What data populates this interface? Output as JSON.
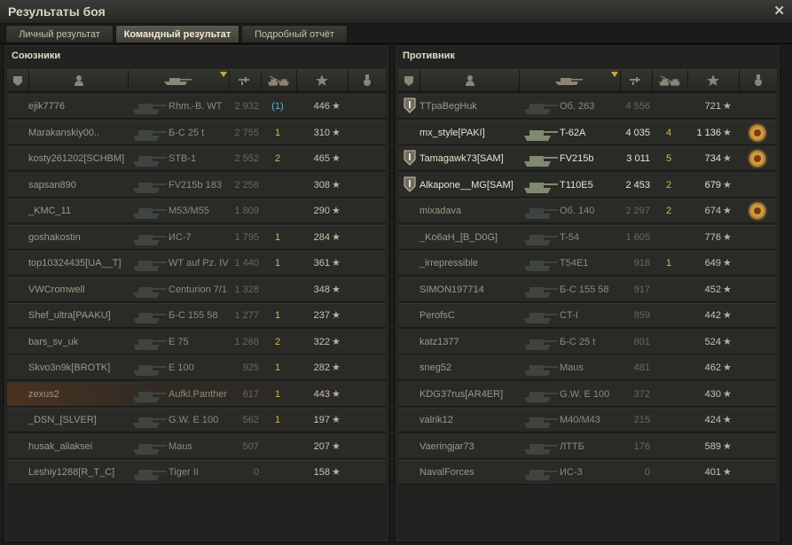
{
  "window": {
    "title": "Результаты боя",
    "close_glyph": "✕"
  },
  "tabs": [
    {
      "label": "Личный результат",
      "active": false
    },
    {
      "label": "Командный результат",
      "active": true
    },
    {
      "label": "Подробный отчёт",
      "active": false
    }
  ],
  "columns": {
    "icons": [
      "squad-icon",
      "player-icon",
      "tank-icon",
      "sort-arrow-icon",
      "damage-icon",
      "kills-icon",
      "xp-star-icon",
      "medal-icon"
    ]
  },
  "allies": {
    "title": "Союзники",
    "rows": [
      {
        "player": "ejik7776",
        "tank": "Rhm.-B. WT",
        "damage": "2 932",
        "kills": "(1)",
        "xp": "446",
        "alive": false,
        "highlight": false,
        "platoon": false,
        "medal": false,
        "prem": true
      },
      {
        "player": "Marakanskiy00..",
        "tank": "Б-С 25 t",
        "damage": "2 755",
        "kills": "1",
        "xp": "310",
        "alive": false,
        "highlight": false,
        "platoon": false,
        "medal": false,
        "prem": false
      },
      {
        "player": "kosty261202[SCHBM]",
        "tank": "STB-1",
        "damage": "2 552",
        "kills": "2",
        "xp": "465",
        "alive": false,
        "highlight": false,
        "platoon": false,
        "medal": false,
        "prem": false
      },
      {
        "player": "sapsan890",
        "tank": "FV215b 183",
        "damage": "2 258",
        "kills": "",
        "xp": "308",
        "alive": false,
        "highlight": false,
        "platoon": false,
        "medal": false,
        "prem": false
      },
      {
        "player": "_KMC_11",
        "tank": "M53/M55",
        "damage": "1 809",
        "kills": "",
        "xp": "290",
        "alive": false,
        "highlight": false,
        "platoon": false,
        "medal": false,
        "prem": false
      },
      {
        "player": "goshakostin",
        "tank": "ИС-7",
        "damage": "1 795",
        "kills": "1",
        "xp": "284",
        "alive": false,
        "highlight": false,
        "platoon": false,
        "medal": false,
        "prem": false
      },
      {
        "player": "top10324435[UA__T]",
        "tank": "WT auf Pz. IV",
        "damage": "1 440",
        "kills": "1",
        "xp": "361",
        "alive": false,
        "highlight": false,
        "platoon": false,
        "medal": false,
        "prem": false
      },
      {
        "player": "VWCromwell",
        "tank": "Centurion 7/1",
        "damage": "1 328",
        "kills": "",
        "xp": "348",
        "alive": false,
        "highlight": false,
        "platoon": false,
        "medal": false,
        "prem": false
      },
      {
        "player": "Shef_ultra[PAAKU]",
        "tank": "Б-С 155 58",
        "damage": "1 277",
        "kills": "1",
        "xp": "237",
        "alive": false,
        "highlight": false,
        "platoon": false,
        "medal": false,
        "prem": false
      },
      {
        "player": "bars_sv_uk",
        "tank": "E 75",
        "damage": "1 268",
        "kills": "2",
        "xp": "322",
        "alive": false,
        "highlight": false,
        "platoon": false,
        "medal": false,
        "prem": false
      },
      {
        "player": "Skvo3n9k[BROTK]",
        "tank": "E 100",
        "damage": "925",
        "kills": "1",
        "xp": "282",
        "alive": false,
        "highlight": false,
        "platoon": false,
        "medal": false,
        "prem": false
      },
      {
        "player": "zexus2",
        "tank": "Aufkl.Panther",
        "damage": "617",
        "kills": "1",
        "xp": "443",
        "alive": false,
        "highlight": true,
        "platoon": false,
        "medal": false,
        "prem": false
      },
      {
        "player": "_DSN_[SLVER]",
        "tank": "G.W. E 100",
        "damage": "562",
        "kills": "1",
        "xp": "197",
        "alive": false,
        "highlight": false,
        "platoon": false,
        "medal": false,
        "prem": false
      },
      {
        "player": "husak_aliaksei",
        "tank": "Maus",
        "damage": "507",
        "kills": "",
        "xp": "207",
        "alive": false,
        "highlight": false,
        "platoon": false,
        "medal": false,
        "prem": false
      },
      {
        "player": "Leshiy1288[R_T_C]",
        "tank": "Tiger II",
        "damage": "0",
        "kills": "",
        "xp": "158",
        "alive": false,
        "highlight": false,
        "platoon": false,
        "medal": false,
        "prem": false
      }
    ]
  },
  "enemies": {
    "title": "Противник",
    "rows": [
      {
        "player": "TTpaBegHuk",
        "tank": "Об. 263",
        "damage": "4 556",
        "kills": "",
        "xp": "721",
        "alive": false,
        "highlight": false,
        "platoon": true,
        "medal": false,
        "prem": false
      },
      {
        "player": "mx_style[PAKI]",
        "tank": "T-62A",
        "damage": "4 035",
        "kills": "4",
        "xp": "1 136",
        "alive": true,
        "highlight": false,
        "platoon": false,
        "medal": true,
        "prem": false
      },
      {
        "player": "Tamagawk73[SAM]",
        "tank": "FV215b",
        "damage": "3 011",
        "kills": "5",
        "xp": "734",
        "alive": true,
        "highlight": false,
        "platoon": true,
        "medal": true,
        "prem": false
      },
      {
        "player": "Alkapone__MG[SAM]",
        "tank": "T110E5",
        "damage": "2 453",
        "kills": "2",
        "xp": "679",
        "alive": true,
        "highlight": false,
        "platoon": true,
        "medal": false,
        "prem": false
      },
      {
        "player": "mixadava",
        "tank": "Об. 140",
        "damage": "2 297",
        "kills": "2",
        "xp": "674",
        "alive": false,
        "highlight": false,
        "platoon": false,
        "medal": true,
        "prem": false
      },
      {
        "player": "_Ko6aH_[B_D0G]",
        "tank": "T-54",
        "damage": "1 605",
        "kills": "",
        "xp": "776",
        "alive": false,
        "highlight": false,
        "platoon": false,
        "medal": false,
        "prem": false
      },
      {
        "player": "_irrepressible",
        "tank": "T54E1",
        "damage": "918",
        "kills": "1",
        "xp": "649",
        "alive": false,
        "highlight": false,
        "platoon": false,
        "medal": false,
        "prem": false
      },
      {
        "player": "SIMON197714",
        "tank": "Б-С 155 58",
        "damage": "917",
        "kills": "",
        "xp": "452",
        "alive": false,
        "highlight": false,
        "platoon": false,
        "medal": false,
        "prem": false
      },
      {
        "player": "PerofsC",
        "tank": "CT-I",
        "damage": "859",
        "kills": "",
        "xp": "442",
        "alive": false,
        "highlight": false,
        "platoon": false,
        "medal": false,
        "prem": false
      },
      {
        "player": "katz1377",
        "tank": "Б-С 25 t",
        "damage": "801",
        "kills": "",
        "xp": "524",
        "alive": false,
        "highlight": false,
        "platoon": false,
        "medal": false,
        "prem": false
      },
      {
        "player": "sneg52",
        "tank": "Maus",
        "damage": "481",
        "kills": "",
        "xp": "462",
        "alive": false,
        "highlight": false,
        "platoon": false,
        "medal": false,
        "prem": false
      },
      {
        "player": "KDG37rus[AR4ER]",
        "tank": "G.W. E 100",
        "damage": "372",
        "kills": "",
        "xp": "430",
        "alive": false,
        "highlight": false,
        "platoon": false,
        "medal": false,
        "prem": false
      },
      {
        "player": "valrik12",
        "tank": "M40/M43",
        "damage": "215",
        "kills": "",
        "xp": "424",
        "alive": false,
        "highlight": false,
        "platoon": false,
        "medal": false,
        "prem": false
      },
      {
        "player": "Vaeringjar73",
        "tank": "ЛТТБ",
        "damage": "176",
        "kills": "",
        "xp": "589",
        "alive": false,
        "highlight": false,
        "platoon": false,
        "medal": false,
        "prem": false
      },
      {
        "player": "NavalForces",
        "tank": "ИС-3",
        "damage": "0",
        "kills": "",
        "xp": "401",
        "alive": false,
        "highlight": false,
        "platoon": false,
        "medal": false,
        "prem": false
      }
    ]
  }
}
